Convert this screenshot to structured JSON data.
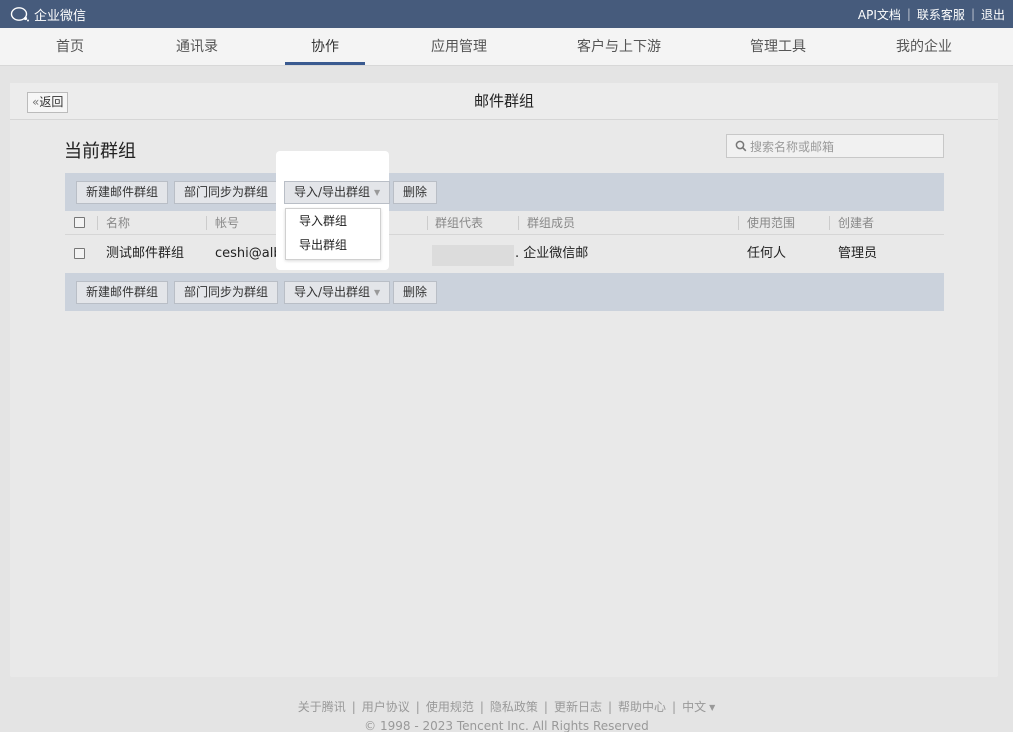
{
  "topbar": {
    "brand": "企业微信",
    "links": [
      "API文档",
      "联系客服",
      "退出"
    ]
  },
  "nav": {
    "items": [
      "首页",
      "通讯录",
      "协作",
      "应用管理",
      "客户与上下游",
      "管理工具",
      "我的企业"
    ],
    "active": "协作"
  },
  "panel": {
    "back_label": "返回",
    "title": "邮件群组",
    "section_title": "当前群组",
    "search_placeholder": "搜索名称或邮箱"
  },
  "toolbar": {
    "new_group": "新建邮件群组",
    "sync_dept": "部门同步为群组",
    "import_export": "导入/导出群组",
    "delete": "删除"
  },
  "dropdown": {
    "options": [
      "导入群组",
      "导出群组"
    ]
  },
  "table": {
    "headers": [
      "名称",
      "帐号",
      "群组代表",
      "群组成员",
      "使用范围",
      "创建者"
    ],
    "rows": [
      {
        "name": "测试邮件群组",
        "account": "ceshi@alb.v",
        "members": "企业微信邮",
        "scope": "任何人",
        "creator": "管理员"
      }
    ]
  },
  "footer": {
    "links": [
      "关于腾讯",
      "用户协议",
      "使用规范",
      "隐私政策",
      "更新日志",
      "帮助中心",
      "中文"
    ],
    "copyright": "© 1998 - 2023 Tencent Inc. All Rights Reserved"
  },
  "colors": {
    "topbar": "#465b7c",
    "nav_underline": "#3a5a90",
    "toolbar": "#cbd2dc"
  }
}
